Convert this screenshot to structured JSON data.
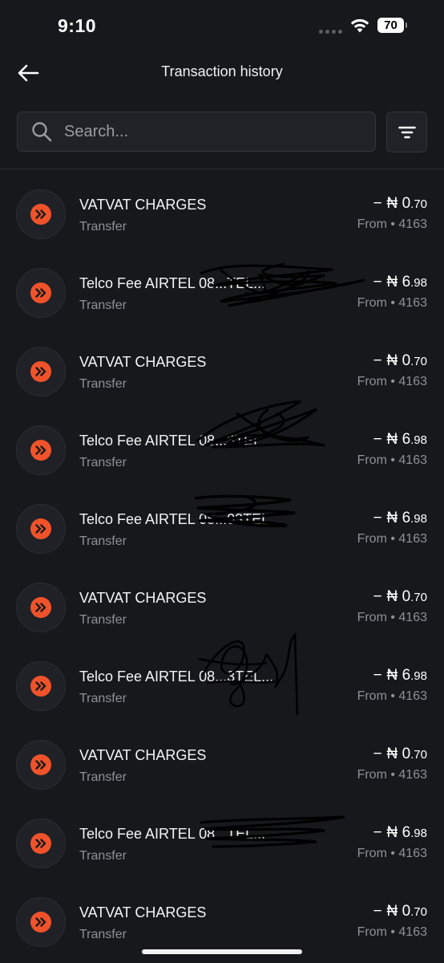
{
  "status_bar": {
    "time": "9:10",
    "battery": "70"
  },
  "header": {
    "title": "Transaction history",
    "back_icon": "arrow-left-icon"
  },
  "search": {
    "placeholder": "Search...",
    "value": "",
    "icon": "search-icon",
    "filter_icon": "filter-icon"
  },
  "transactions": [
    {
      "title": "VATVAT CHARGES",
      "subtitle": "Transfer",
      "sign": "−",
      "currency": "₦",
      "whole": "0",
      "decimals": ".70",
      "meta": "From • 4163",
      "redacted": false
    },
    {
      "title": "Telco Fee AIRTEL 08...TEL...",
      "subtitle": "Transfer",
      "sign": "−",
      "currency": "₦",
      "whole": "6",
      "decimals": ".98",
      "meta": "From • 4163",
      "redacted": true
    },
    {
      "title": "VATVAT CHARGES",
      "subtitle": "Transfer",
      "sign": "−",
      "currency": "₦",
      "whole": "0",
      "decimals": ".70",
      "meta": "From • 4163",
      "redacted": false
    },
    {
      "title": "Telco Fee AIRTEL 08...3TEL...",
      "subtitle": "Transfer",
      "sign": "−",
      "currency": "₦",
      "whole": "6",
      "decimals": ".98",
      "meta": "From • 4163",
      "redacted": true
    },
    {
      "title": "Telco Fee AIRTEL 08...03TEL...",
      "subtitle": "Transfer",
      "sign": "−",
      "currency": "₦",
      "whole": "6",
      "decimals": ".98",
      "meta": "From • 4163",
      "redacted": true
    },
    {
      "title": "VATVAT CHARGES",
      "subtitle": "Transfer",
      "sign": "−",
      "currency": "₦",
      "whole": "0",
      "decimals": ".70",
      "meta": "From • 4163",
      "redacted": false
    },
    {
      "title": "Telco Fee AIRTEL 08...3TEL...",
      "subtitle": "Transfer",
      "sign": "−",
      "currency": "₦",
      "whole": "6",
      "decimals": ".98",
      "meta": "From • 4163",
      "redacted": true
    },
    {
      "title": "VATVAT CHARGES",
      "subtitle": "Transfer",
      "sign": "−",
      "currency": "₦",
      "whole": "0",
      "decimals": ".70",
      "meta": "From • 4163",
      "redacted": false
    },
    {
      "title": "Telco Fee AIRTEL 08...TEL...",
      "subtitle": "Transfer",
      "sign": "−",
      "currency": "₦",
      "whole": "6",
      "decimals": ".98",
      "meta": "From • 4163",
      "redacted": true
    },
    {
      "title": "VATVAT CHARGES",
      "subtitle": "Transfer",
      "sign": "−",
      "currency": "₦",
      "whole": "0",
      "decimals": ".70",
      "meta": "From • 4163",
      "redacted": false
    }
  ],
  "colors": {
    "background": "#17181c",
    "accent": "#f0532b",
    "muted_text": "#8e9096"
  }
}
